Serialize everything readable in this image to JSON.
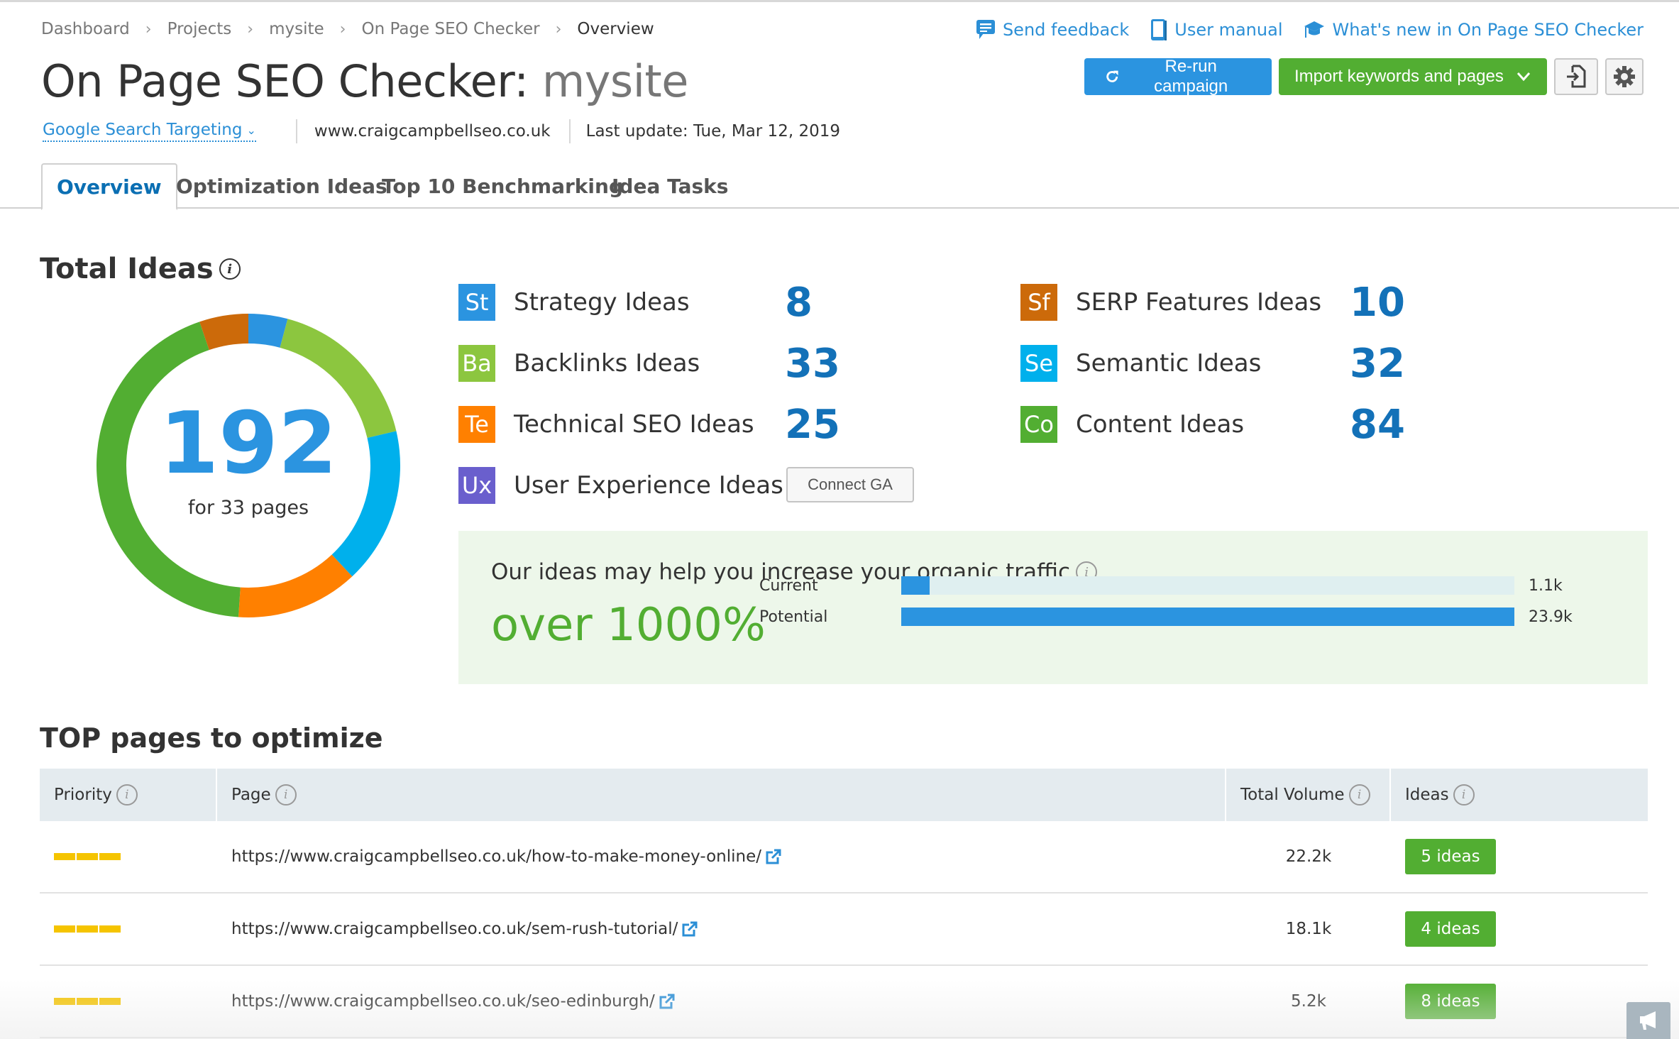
{
  "breadcrumb": [
    "Dashboard",
    "Projects",
    "mysite",
    "On Page SEO Checker",
    "Overview"
  ],
  "header": {
    "title": "On Page SEO Checker:",
    "project": "mysite",
    "targeting": "Google Search Targeting",
    "domain": "www.craigcampbellseo.co.uk",
    "last_update": "Last update: Tue, Mar 12, 2019"
  },
  "help_links": {
    "feedback": "Send feedback",
    "manual": "User manual",
    "whats_new": "What's new in On Page SEO Checker"
  },
  "actions": {
    "rerun": "Re-run campaign",
    "import": "Import keywords and pages"
  },
  "tabs": [
    "Overview",
    "Optimization Ideas",
    "Top 10 Benchmarking",
    "Idea Tasks"
  ],
  "total_ideas": {
    "title": "Total Ideas",
    "total": "192",
    "subtitle": "for 33 pages"
  },
  "categories": [
    {
      "abbr": "St",
      "label": "Strategy Ideas",
      "value": "8",
      "color": "#2b94e0"
    },
    {
      "abbr": "Ba",
      "label": "Backlinks Ideas",
      "value": "33",
      "color": "#8cc63f"
    },
    {
      "abbr": "Te",
      "label": "Technical SEO Ideas",
      "value": "25",
      "color": "#ff8000"
    },
    {
      "abbr": "Ux",
      "label": "User Experience Ideas",
      "value": "",
      "color": "#6a5fcd"
    },
    {
      "abbr": "Sf",
      "label": "SERP Features Ideas",
      "value": "10",
      "color": "#cc6a0a"
    },
    {
      "abbr": "Se",
      "label": "Semantic Ideas",
      "value": "32",
      "color": "#00b0ec"
    },
    {
      "abbr": "Co",
      "label": "Content Ideas",
      "value": "84",
      "color": "#52ae32"
    }
  ],
  "connect_ga": "Connect GA",
  "traffic": {
    "title": "Our ideas may help you increase your organic traffic",
    "headline": "over 1000%",
    "rows": [
      {
        "label": "Current",
        "value": "1.1k",
        "fraction": 0.046
      },
      {
        "label": "Potential",
        "value": "23.9k",
        "fraction": 1.0
      }
    ]
  },
  "top_pages": {
    "title": "TOP pages to optimize",
    "columns": [
      "Priority",
      "Page",
      "Total Volume",
      "Ideas"
    ],
    "rows": [
      {
        "priority": 3,
        "url": "https://www.craigcampbellseo.co.uk/how-to-make-money-online/",
        "volume": "22.2k",
        "ideas": "5 ideas"
      },
      {
        "priority": 3,
        "url": "https://www.craigcampbellseo.co.uk/sem-rush-tutorial/",
        "volume": "18.1k",
        "ideas": "4 ideas"
      },
      {
        "priority": 3,
        "url": "https://www.craigcampbellseo.co.uk/seo-edinburgh/",
        "volume": "5.2k",
        "ideas": "8 ideas"
      }
    ]
  },
  "chart_data": {
    "type": "pie",
    "title": "Total Ideas",
    "center_label": "192",
    "slices": [
      {
        "name": "Strategy Ideas",
        "value": 8,
        "color": "#2b94e0"
      },
      {
        "name": "Backlinks Ideas",
        "value": 33,
        "color": "#8cc63f"
      },
      {
        "name": "Semantic Ideas",
        "value": 32,
        "color": "#00b0ec"
      },
      {
        "name": "Technical SEO Ideas",
        "value": 25,
        "color": "#ff8000"
      },
      {
        "name": "Content Ideas",
        "value": 84,
        "color": "#52ae32"
      },
      {
        "name": "SERP Features Ideas",
        "value": 10,
        "color": "#cc6a0a"
      }
    ]
  }
}
